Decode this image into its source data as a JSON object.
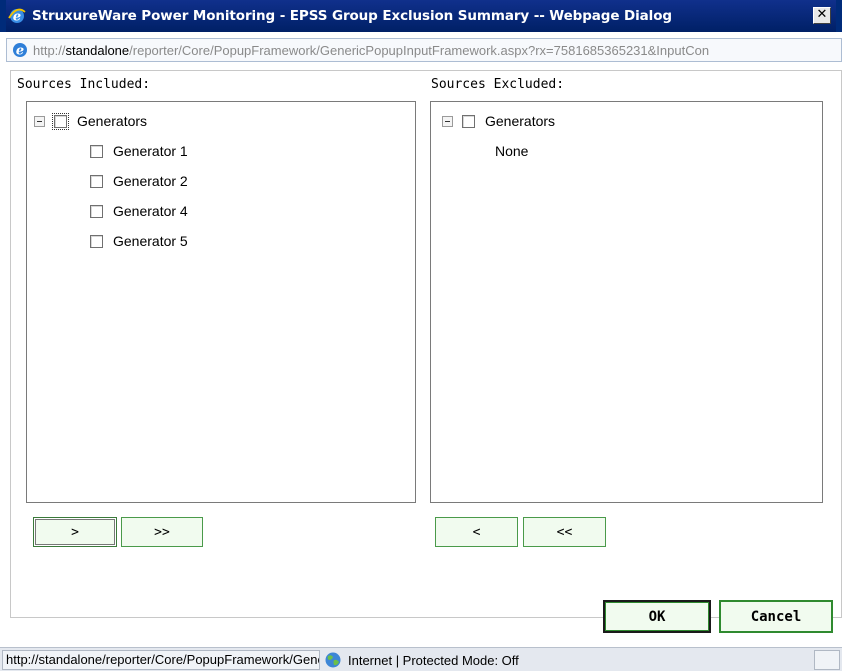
{
  "window": {
    "title": "StruxureWare Power Monitoring - EPSS Group Exclusion Summary -- Webpage Dialog",
    "close_glyph": "✕",
    "icon": "ie-icon"
  },
  "address": {
    "prefix": "http://",
    "host": "standalone",
    "path": "/reporter/Core/PopupFramework/GenericPopupInputFramework.aspx?rx=7581685365231&InputCon"
  },
  "included": {
    "label": "Sources Included:",
    "group": "Generators",
    "items": [
      "Generator 1",
      "Generator 2",
      "Generator 4",
      "Generator 5"
    ],
    "buttons": {
      "move_one": ">",
      "move_all": ">>"
    }
  },
  "excluded": {
    "label": "Sources Excluded:",
    "group": "Generators",
    "empty_text": "None",
    "buttons": {
      "move_one": "<",
      "move_all": "<<"
    }
  },
  "footer": {
    "ok": "OK",
    "cancel": "Cancel"
  },
  "status": {
    "url": "http://standalone/reporter/Core/PopupFramework/GenericPopupInputFramework.aspx",
    "zone": "Internet | Protected Mode: Off"
  },
  "colors": {
    "titlebar": "#10308c",
    "button_border": "#2f8a2f",
    "button_fill": "#f1fbef"
  }
}
